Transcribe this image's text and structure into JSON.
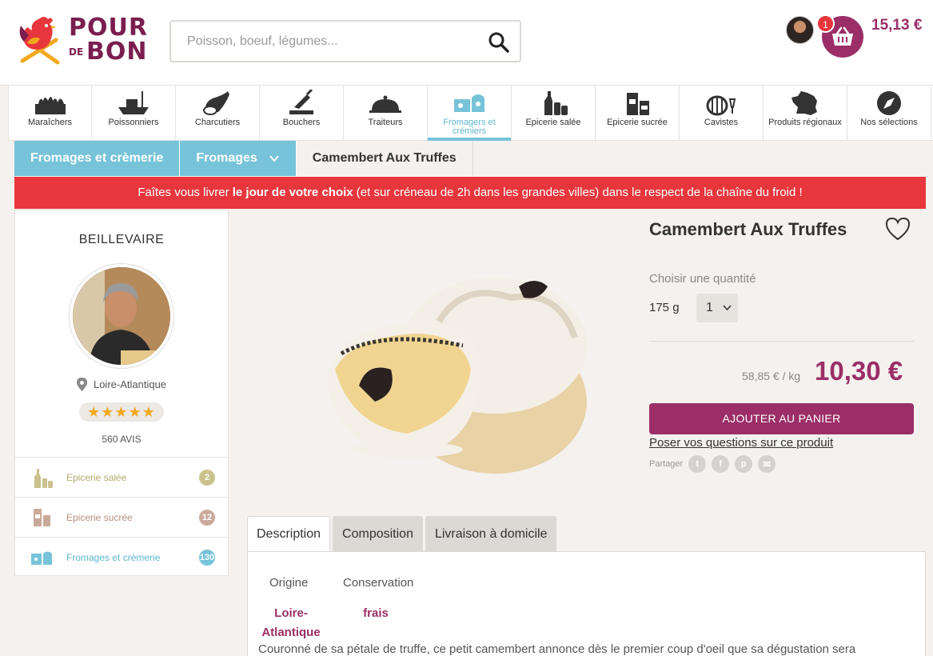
{
  "header": {
    "logo": {
      "line1": "POUR",
      "line2_small": "DE",
      "line2": "BON"
    },
    "search": {
      "placeholder": "Poisson, boeuf, légumes...",
      "value": ""
    },
    "cart": {
      "badge": "1",
      "total": "15,13 €"
    }
  },
  "nav": {
    "items": [
      {
        "label": "Maraîchers",
        "icon": "vegetable-crate-icon"
      },
      {
        "label": "Poissonniers",
        "icon": "boat-icon"
      },
      {
        "label": "Charcutiers",
        "icon": "ham-icon"
      },
      {
        "label": "Bouchers",
        "icon": "cleaver-icon"
      },
      {
        "label": "Traiteurs",
        "icon": "cloche-icon"
      },
      {
        "label": "Fromagers et crémiers",
        "icon": "cheese-icon",
        "active": true
      },
      {
        "label": "Epicerie salée",
        "icon": "bottles-icon"
      },
      {
        "label": "Epicerie sucrée",
        "icon": "jars-icon"
      },
      {
        "label": "Cavistes",
        "icon": "barrel-icon"
      },
      {
        "label": "Produits régionaux",
        "icon": "france-map-icon"
      },
      {
        "label": "Nos sélections",
        "icon": "compass-icon"
      }
    ]
  },
  "breadcrumb": {
    "level1": "Fromages et crèmerie",
    "level2": "Fromages",
    "current": "Camembert Aux Truffes"
  },
  "banner": {
    "before": "Faîtes vous livrer ",
    "bold": "le jour de votre choix",
    "after": " (et sur créneau de 2h dans les grandes villes) dans le respect de la chaîne du froid !"
  },
  "seller": {
    "name": "BEILLEVAIRE",
    "location": "Loire-Atlantique",
    "rating_stars": "★★★★★",
    "rating": 5,
    "reviews": "560 AVIS",
    "categories": [
      {
        "label": "Epicerie salée",
        "count": "2",
        "color": "#c9c28c"
      },
      {
        "label": "Epicerie sucrée",
        "count": "12",
        "color": "#c9a99a"
      },
      {
        "label": "Fromages et crèmerie",
        "count": "130",
        "color": "#77c3d9"
      }
    ]
  },
  "product": {
    "title": "Camembert Aux Truffes",
    "choose_label": "Choisir une quantité",
    "weight": "175 g",
    "quantity": "1",
    "price_per_kg": "58,85 € / kg",
    "price": "10,30 €",
    "add_to_cart": "AJOUTER AU PANIER",
    "ask_link": "Poser vos questions sur ce produit",
    "share_label": "Partager",
    "share_icons": [
      "twitter-icon",
      "facebook-icon",
      "pinterest-icon",
      "email-icon"
    ]
  },
  "tabs": {
    "items": [
      "Description",
      "Composition",
      "Livraison à domicile"
    ],
    "active": "Description"
  },
  "description": {
    "origin_label": "Origine",
    "origin_value_l1": "Loire-",
    "origin_value_l2": "Atlantique",
    "conservation_label": "Conservation",
    "conservation_value": "frais",
    "text": "Couronné de sa pétale de truffe, ce petit camembert annonce dès le premier coup d'oeil que sa dégustation sera"
  },
  "colors": {
    "brand": "#9b2e67",
    "accent_blue": "#77c3d9",
    "banner_red": "#e8363d",
    "star": "#f2a81e"
  }
}
